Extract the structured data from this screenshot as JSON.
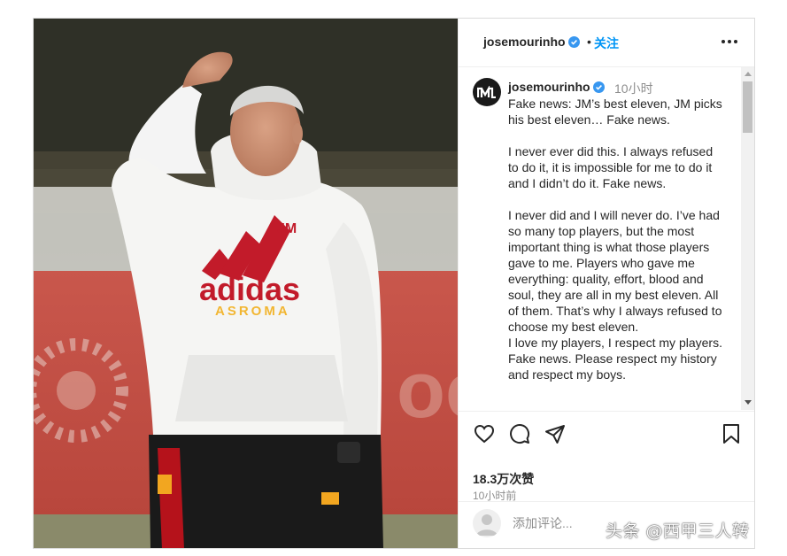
{
  "header": {
    "username": "josemourinho",
    "separator": "•",
    "follow_label": "关注",
    "more_icon": "more-horizontal-icon"
  },
  "caption": {
    "username": "josemourinho",
    "time": "10小时",
    "lines": [
      "Fake news: JM’s best eleven, JM picks his best eleven… Fake news.",
      "",
      "I never ever did this. I always refused to do it, it is impossible for me to do it and I didn’t do it. Fake news.",
      "",
      "I never did and I will never do. I’ve had so many top players, but the most important thing is what those players gave to me. Players who gave me everything: quality, effort, blood and soul, they are all in my best eleven. All of them. That’s why I always refused to choose my best eleven.",
      "I love my players, I respect my players.",
      "Fake news. Please respect my history and respect my boys."
    ]
  },
  "photo": {
    "shirt_brand": "adidas",
    "shirt_club": "ASROMA",
    "badge_text": "JM"
  },
  "actions": {
    "like_icon": "heart-icon",
    "comment_icon": "comment-icon",
    "share_icon": "send-icon",
    "save_icon": "bookmark-icon"
  },
  "likes": "18.3万次赞",
  "time_ago": "10小时前",
  "add_comment": {
    "placeholder": "添加评论..."
  },
  "watermark": "头条 @西甲三人转",
  "colors": {
    "accent": "#0095f6",
    "verified": "#3897f0",
    "text": "#262626",
    "muted": "#8e8e8e"
  }
}
